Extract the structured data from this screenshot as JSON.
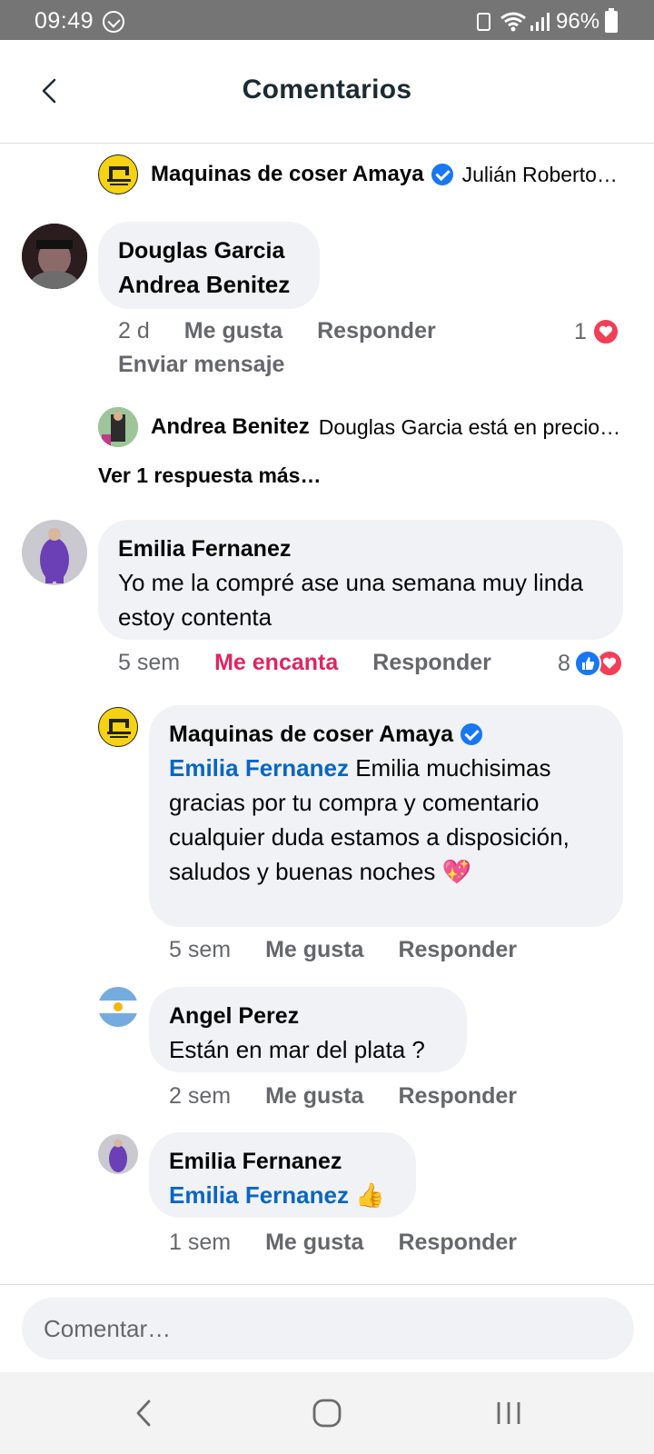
{
  "status_bar": {
    "time": "09:49",
    "battery_percent": "96%",
    "icons": [
      "whatsapp-icon",
      "battery-saver-icon",
      "wifi-icon",
      "signal-icon",
      "battery-icon"
    ]
  },
  "header": {
    "title": "Comentarios",
    "back_icon": "chevron-left-icon"
  },
  "colors": {
    "mention": "#0a66c2",
    "love": "#e0245e",
    "bubble": "#f0f2f5",
    "verified": "#1877f2"
  },
  "collapsed_top": {
    "author": "Maquinas de coser Amaya",
    "verified": true,
    "snippet": "Julián Roberto…"
  },
  "comment1": {
    "author": "Douglas Garcia",
    "mention": "Andrea Benitez",
    "time": "2 d",
    "like_label": "Me gusta",
    "reply_label": "Responder",
    "message_label": "Enviar mensaje",
    "reaction_count": "1"
  },
  "collapsed_reply": {
    "author": "Andrea Benitez",
    "snippet": "Douglas Garcia está en precio…"
  },
  "more_replies_label": "Ver 1 respuesta más…",
  "comment2": {
    "author": "Emilia Fernanez",
    "text": "Yo  me la compré ase una semana muy linda estoy contenta",
    "time": "5 sem",
    "like_label": "Me encanta",
    "reply_label": "Responder",
    "reaction_count": "8"
  },
  "reply1": {
    "author": "Maquinas de coser Amaya",
    "verified": true,
    "mention": "Emilia Fernanez",
    "text": " Emilia muchisimas gracias por tu compra y comentario cualquier duda estamos a disposición, saludos y buenas noches",
    "emoji": "💖",
    "time": "5 sem",
    "like_label": "Me gusta",
    "reply_label": "Responder"
  },
  "reply2": {
    "author": "Angel Perez",
    "text": "Están en mar del plata ?",
    "time": "2 sem",
    "like_label": "Me gusta",
    "reply_label": "Responder"
  },
  "reply3": {
    "author": "Emilia Fernanez",
    "mention": "Emilia Fernanez",
    "emoji": "👍",
    "time": "1 sem",
    "like_label": "Me gusta",
    "reply_label": "Responder"
  },
  "composer": {
    "placeholder": "Comentar…"
  },
  "nav_bar": {
    "icons": [
      "nav-back-icon",
      "nav-home-icon",
      "nav-recents-icon"
    ]
  }
}
